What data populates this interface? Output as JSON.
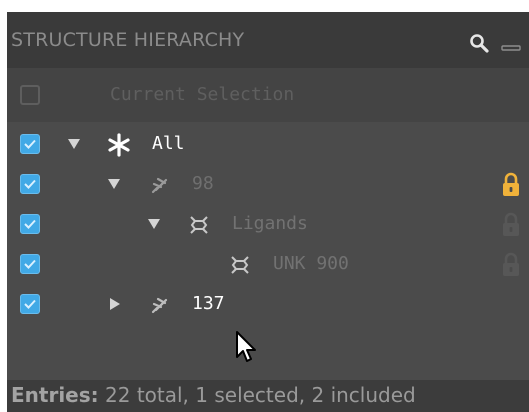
{
  "panel": {
    "title": "STRUCTURE HIERARCHY",
    "header_icons": [
      "search-icon",
      "minimize-icon"
    ]
  },
  "selection": {
    "label": "Current Selection",
    "checked": false
  },
  "tree": [
    {
      "label": "All",
      "checked": true,
      "expanded": true,
      "icon": "asterisk-icon",
      "level": 0,
      "locked": null
    },
    {
      "label": "98",
      "checked": true,
      "expanded": true,
      "icon": "protein-chain-icon",
      "level": 1,
      "locked": "locked"
    },
    {
      "label": "Ligands",
      "checked": true,
      "expanded": true,
      "icon": "ligand-icon",
      "level": 2,
      "locked": "locked-dim"
    },
    {
      "label": "UNK 900",
      "checked": true,
      "expanded": null,
      "icon": "ligand-icon",
      "level": 3,
      "locked": "locked-dim"
    },
    {
      "label": "137",
      "checked": true,
      "expanded": false,
      "icon": "protein-chain-icon",
      "level": 1,
      "locked": null
    }
  ],
  "footer": {
    "label": "Entries:",
    "text": " 22 total, 1 selected, 2 included"
  },
  "colors": {
    "panel_bg": "#4b4b4b",
    "header_bg": "#3a3a3a",
    "checkbox_checked": "#41a9e6",
    "lock_active": "#f0b23a",
    "text_bright": "#ffffff",
    "text_dim": "#7a7a7a"
  }
}
